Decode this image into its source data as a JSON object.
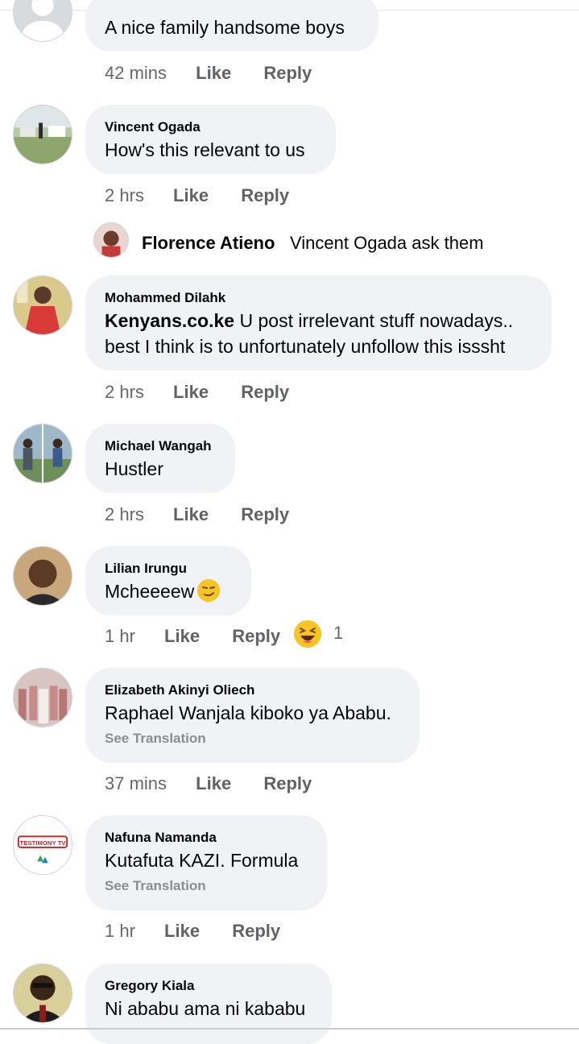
{
  "comments": [
    {
      "name": "",
      "text": "A nice family handsome boys",
      "time": "42 mins",
      "like": "Like",
      "reply": "Reply"
    },
    {
      "name": "Vincent Ogada",
      "text": "How's this relevant to us",
      "time": "2 hrs",
      "like": "Like",
      "reply": "Reply"
    },
    {
      "name": "Mohammed Dilahk",
      "mention": "Kenyans.co.ke",
      "text_after_mention": " U post irrelevant stuff nowadays..",
      "text_line2": "best I think is to unfortunately unfollow this isssht",
      "time": "2 hrs",
      "like": "Like",
      "reply": "Reply"
    },
    {
      "name": "Michael Wangah",
      "text": "Hustler",
      "time": "2 hrs",
      "like": "Like",
      "reply": "Reply"
    },
    {
      "name": "Lilian Irungu",
      "text": "Mcheeeew",
      "emoji": "smirk-emoji",
      "time": "1 hr",
      "like": "Like",
      "reply": "Reply",
      "reaction_emoji": "laughing-emoji",
      "reaction_count": "1"
    },
    {
      "name": "Elizabeth Akinyi Oliech",
      "text": "Raphael Wanjala kiboko ya Ababu.",
      "see_translation": "See Translation",
      "time": "37 mins",
      "like": "Like",
      "reply": "Reply"
    },
    {
      "name": "Nafuna Namanda",
      "text": "Kutafuta KAZI. Formula",
      "see_translation": "See Translation",
      "time": "1 hr",
      "like": "Like",
      "reply": "Reply"
    },
    {
      "name": "Gregory Kiala",
      "text": "Ni ababu ama ni kababu"
    }
  ],
  "reply_preview": {
    "name": "Florence Atieno",
    "text": "Vincent Ogada ask them"
  },
  "avatar_logo_text": "TESTIMONY TV",
  "colors": {
    "bubble": "#f0f2f5",
    "meta": "#65676b",
    "text": "#050505"
  }
}
